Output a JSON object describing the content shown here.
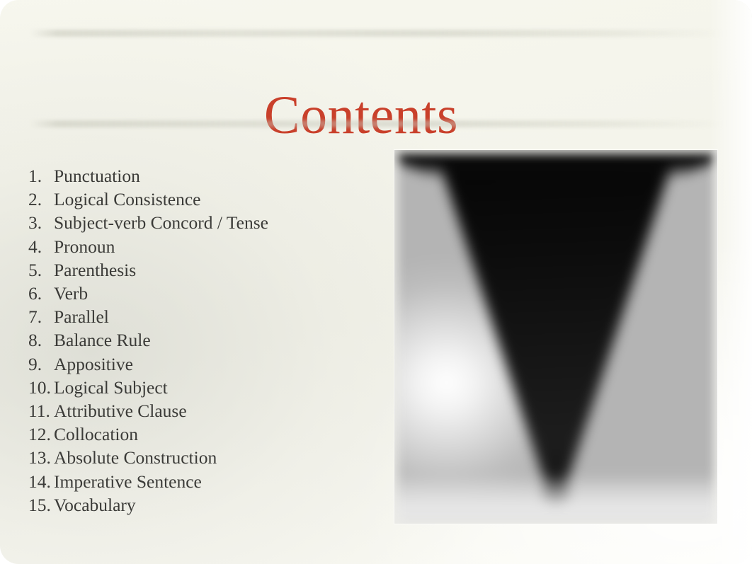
{
  "slide": {
    "title": "Contents",
    "title_color": "#c9402b",
    "background_color": "#f5f5ec",
    "body_text_color": "#3b3b38"
  },
  "contents": {
    "items": [
      {
        "number": "1.",
        "label": "Punctuation"
      },
      {
        "number": "2.",
        "label": "Logical Consistence"
      },
      {
        "number": "3.",
        "label": "Subject-verb Concord / Tense"
      },
      {
        "number": "4.",
        "label": "Pronoun"
      },
      {
        "number": "5.",
        "label": "Parenthesis"
      },
      {
        "number": "6.",
        "label": "Verb"
      },
      {
        "number": "7.",
        "label": "Parallel"
      },
      {
        "number": "8.",
        "label": "Balance Rule"
      },
      {
        "number": "9.",
        "label": "Appositive"
      },
      {
        "number": "10.",
        "label": "Logical Subject"
      },
      {
        "number": "11.",
        "label": "Attributive Clause"
      },
      {
        "number": "12.",
        "label": "Collocation"
      },
      {
        "number": "13.",
        "label": "Absolute Construction"
      },
      {
        "number": "14.",
        "label": "Imperative Sentence"
      },
      {
        "number": "15.",
        "label": "Vocabulary"
      }
    ]
  },
  "photo": {
    "description": "blurred black-and-white photograph of a dark inverted cone on a grey background",
    "palette": {
      "cone": "#0d0d0d",
      "background_light": "#ffffff",
      "background_mid": "#b6b6b6"
    }
  }
}
